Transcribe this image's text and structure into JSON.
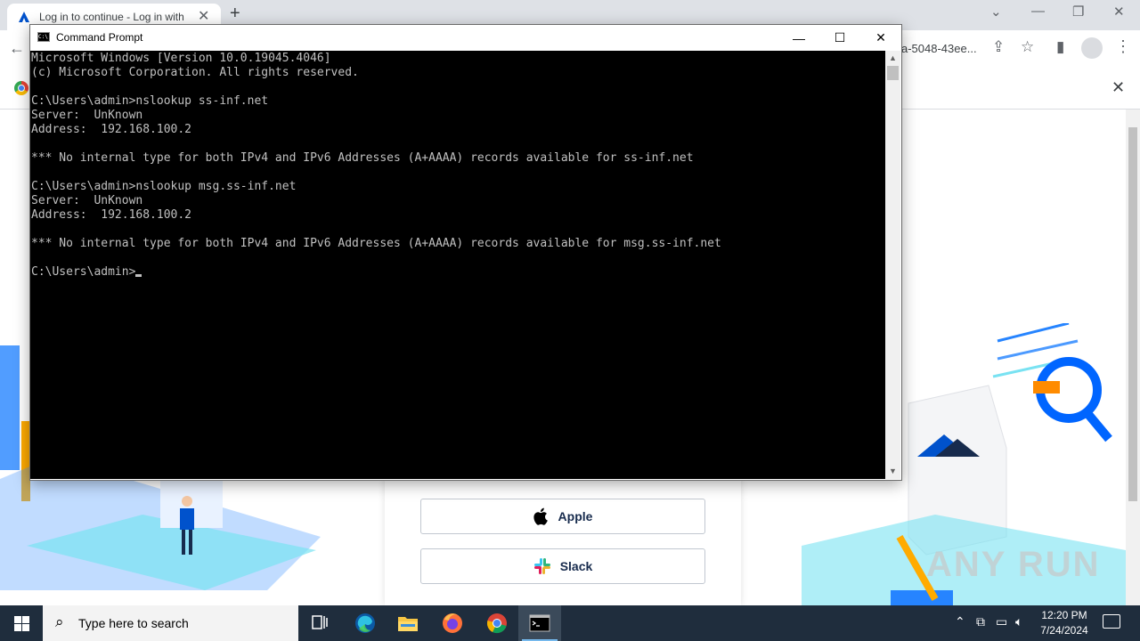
{
  "browser": {
    "tab_title": "Log in to continue - Log in with",
    "omnibox_partial": "a-5048-43ee...",
    "login": {
      "buttons": [
        {
          "label": "Apple",
          "icon": "apple-icon"
        },
        {
          "label": "Slack",
          "icon": "slack-icon"
        }
      ]
    },
    "watermark": "ANY RUN"
  },
  "cmd": {
    "title": "Command Prompt",
    "lines": [
      "Microsoft Windows [Version 10.0.19045.4046]",
      "(c) Microsoft Corporation. All rights reserved.",
      "",
      "C:\\Users\\admin>nslookup ss-inf.net",
      "Server:  UnKnown",
      "Address:  192.168.100.2",
      "",
      "*** No internal type for both IPv4 and IPv6 Addresses (A+AAAA) records available for ss-inf.net",
      "",
      "C:\\Users\\admin>nslookup msg.ss-inf.net",
      "Server:  UnKnown",
      "Address:  192.168.100.2",
      "",
      "*** No internal type for both IPv4 and IPv6 Addresses (A+AAAA) records available for msg.ss-inf.net",
      ""
    ],
    "prompt": "C:\\Users\\admin>"
  },
  "taskbar": {
    "search_placeholder": "Type here to search",
    "apps": [
      "task-view",
      "edge",
      "file-explorer",
      "firefox",
      "chrome",
      "command-prompt"
    ],
    "time": "12:20 PM",
    "date": "7/24/2024"
  },
  "colors": {
    "console_bg": "#000000",
    "console_fg": "#c0c0c0",
    "taskbar_bg": "#1f2d3d",
    "atlassian_blue": "#0052cc"
  }
}
